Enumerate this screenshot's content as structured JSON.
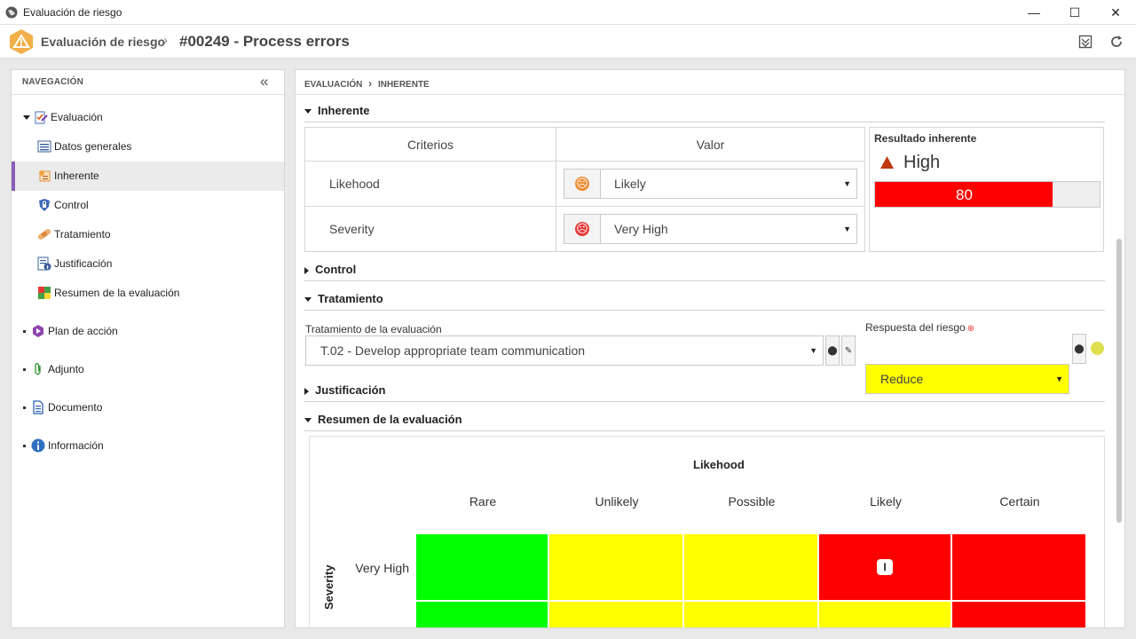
{
  "window": {
    "title": "Evaluación de riesgo",
    "minimize": "—",
    "maximize": "☐",
    "close": "✕"
  },
  "header": {
    "breadcrumb_root": "Evaluación de riesgo",
    "breadcrumb_sep": "›",
    "record": "#00249 - Process errors"
  },
  "nav": {
    "title": "NAVEGACIÓN",
    "collapse": "«",
    "items": [
      {
        "label": "Evaluación",
        "icon": "clipboard-check-icon"
      },
      {
        "label": "Datos generales",
        "icon": "list-icon"
      },
      {
        "label": "Inherente",
        "icon": "inherent-risk-icon",
        "selected": true
      },
      {
        "label": "Control",
        "icon": "shield-icon"
      },
      {
        "label": "Tratamiento",
        "icon": "bandage-icon"
      },
      {
        "label": "Justificación",
        "icon": "justification-icon"
      },
      {
        "label": "Resumen de la evaluación",
        "icon": "heatmap-icon"
      },
      {
        "label": "Plan de acción",
        "icon": "action-plan-icon"
      },
      {
        "label": "Adjunto",
        "icon": "paperclip-icon"
      },
      {
        "label": "Documento",
        "icon": "document-icon"
      },
      {
        "label": "Información",
        "icon": "info-icon"
      }
    ]
  },
  "main": {
    "breadcrumb": [
      "EVALUACIÓN",
      "INHERENTE"
    ],
    "inherente": {
      "title": "Inherente",
      "col_criterios": "Criterios",
      "col_valor": "Valor",
      "rows": [
        {
          "criterio": "Likehood",
          "valor": "Likely",
          "face": "☹",
          "face_color": "#f08a30"
        },
        {
          "criterio": "Severity",
          "valor": "Very High",
          "face": "☹",
          "face_color": "#e53935"
        }
      ],
      "resultado_label": "Resultado inherente",
      "resultado_level": "High",
      "resultado_value": "80",
      "resultado_fraction": 0.79,
      "bar_color": "#ff0000"
    },
    "control": {
      "title": "Control"
    },
    "tratamiento": {
      "title": "Tratamiento",
      "field_label": "Tratamiento de la evaluación",
      "field_value": "T.02 - Develop appropriate team communication",
      "respuesta_label": "Respuesta del riesgo",
      "respuesta_value": "Reduce",
      "respuesta_color": "#ffff00"
    },
    "justificacion": {
      "title": "Justificación"
    },
    "resumen": {
      "title": "Resumen de la evaluación",
      "x_title": "Likehood",
      "y_title": "Severity",
      "columns": [
        "Rare",
        "Unlikely",
        "Possible",
        "Likely",
        "Certain"
      ],
      "rows": [
        {
          "label": "Very High",
          "cells": [
            "#00ff00",
            "#ffff00",
            "#ffff00",
            "#ff0000",
            "#ff0000"
          ],
          "marker_col": 3,
          "marker": "I"
        },
        {
          "label": "",
          "cells": [
            "#00ff00",
            "#ffff00",
            "#ffff00",
            "#ffff00",
            "#ff0000"
          ]
        }
      ]
    }
  }
}
